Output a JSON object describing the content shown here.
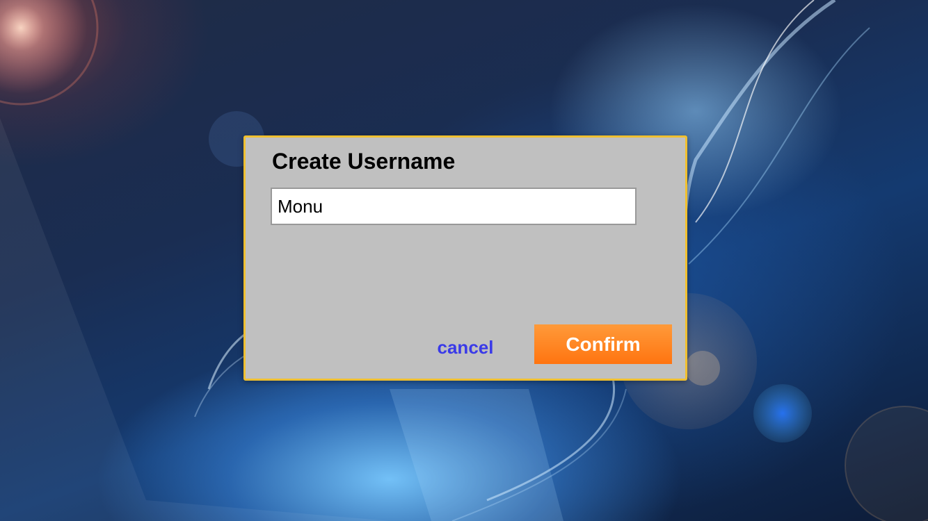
{
  "dialog": {
    "title": "Create Username",
    "input_value": "Monu",
    "cancel_label": "cancel",
    "confirm_label": "Confirm"
  },
  "colors": {
    "dialog_background": "#c0c0c0",
    "dialog_border": "#f0c030",
    "cancel_text": "#3a3ae8",
    "confirm_button": "#ff7d1a",
    "confirm_text": "#ffffff"
  }
}
